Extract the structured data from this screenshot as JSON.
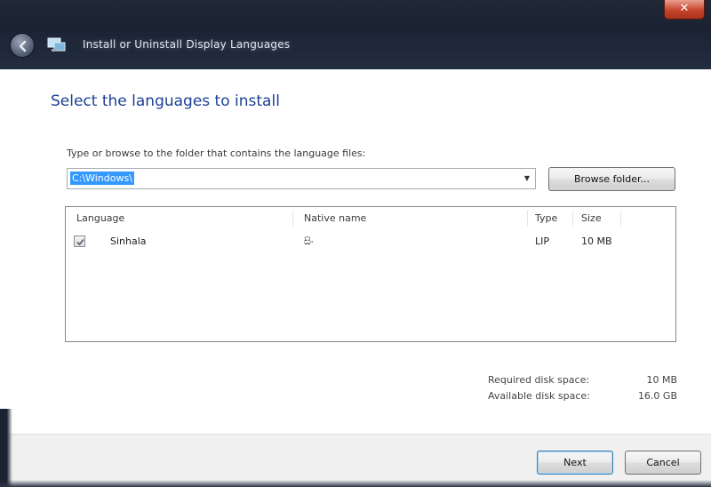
{
  "window": {
    "title": "Install or Uninstall Display Languages",
    "close_glyph": "✕"
  },
  "page": {
    "heading": "Select the languages to install",
    "instruction": "Type or browse to the folder that contains the language files:"
  },
  "path_combo": {
    "value": "C:\\Windows\\",
    "dropdown_glyph": "▼"
  },
  "browse_button": {
    "label": "Browse folder..."
  },
  "table": {
    "columns": [
      "Language",
      "Native name",
      "Type",
      "Size"
    ],
    "rows": [
      {
        "checked": true,
        "language": "Sinhala",
        "native_name": "සිං",
        "type": "LIP",
        "size": "10 MB"
      }
    ]
  },
  "disk": {
    "required_label": "Required disk space:",
    "required_value": "10 MB",
    "available_label": "Available disk space:",
    "available_value": "16.0 GB"
  },
  "footer": {
    "next_label": "Next",
    "cancel_label": "Cancel"
  },
  "colors": {
    "heading": "#1c3f94",
    "titlebar": "#1b2333",
    "selection": "#3399ff",
    "close_button": "#c7442c"
  },
  "icons": {
    "back": "back-arrow-icon",
    "app": "language-app-icon",
    "close": "close-icon",
    "dropdown": "chevron-down-icon",
    "check": "checkmark-icon"
  }
}
